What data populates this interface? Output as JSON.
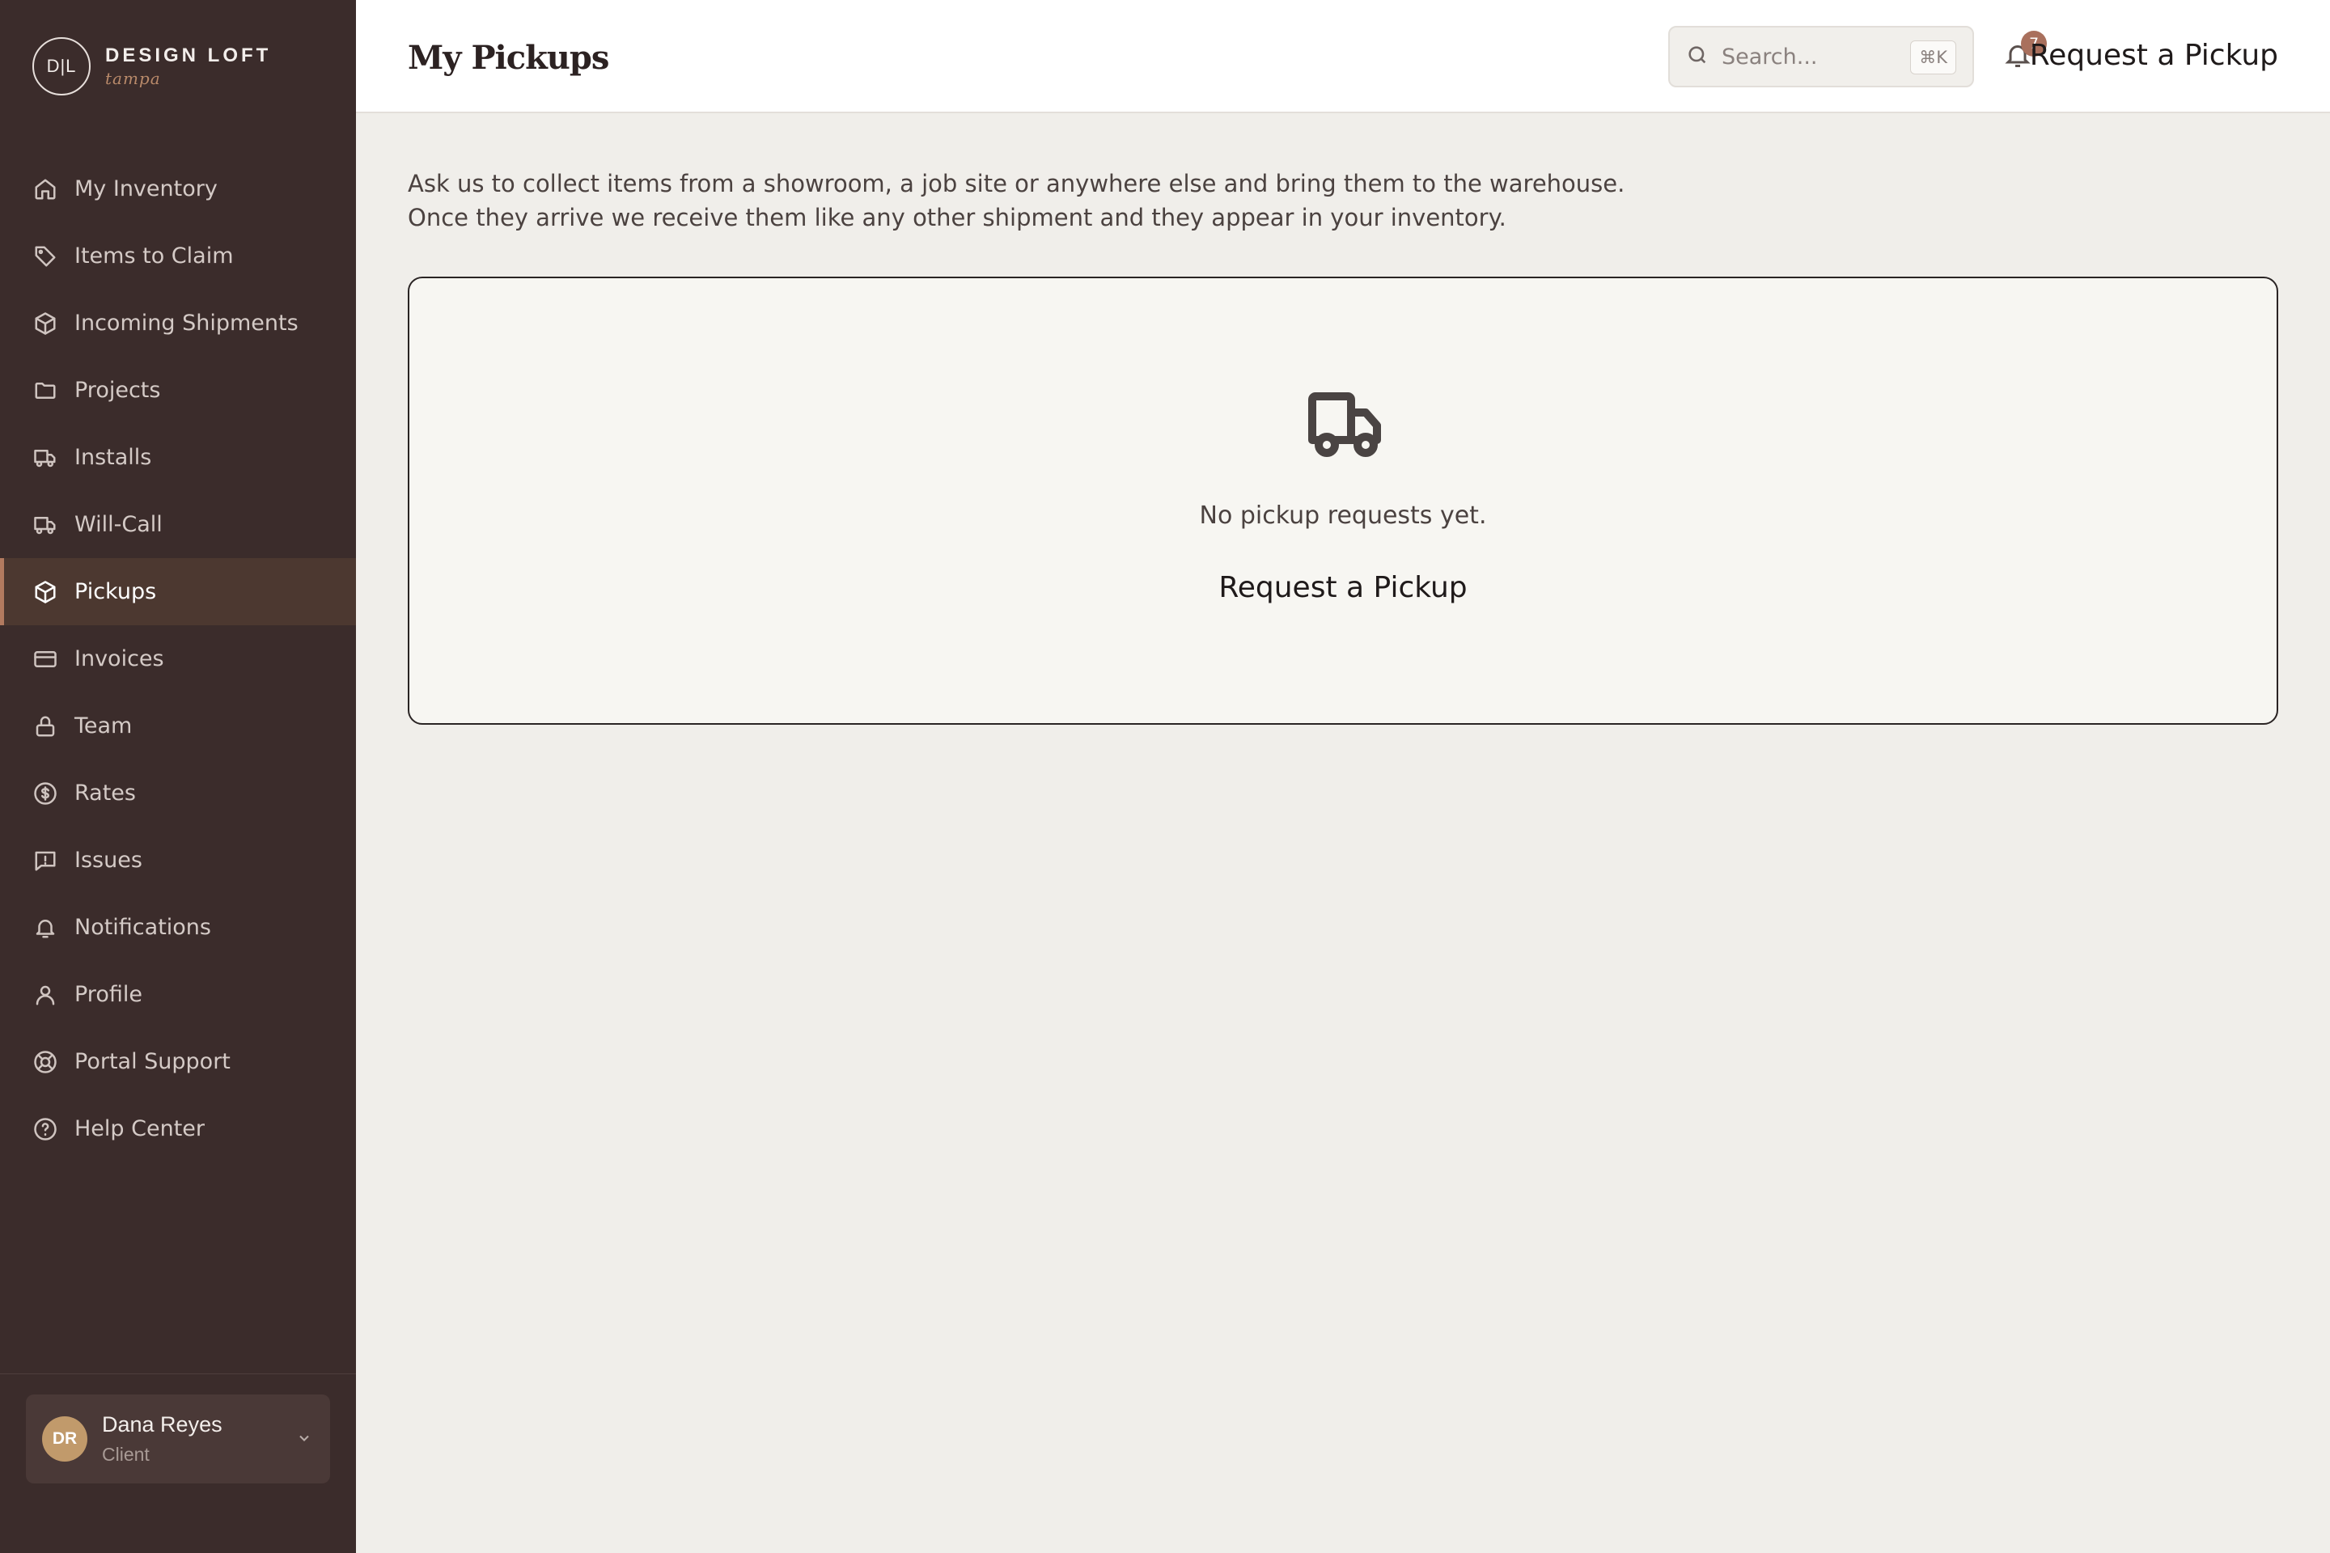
{
  "brand": {
    "initials": "D|L",
    "name": "DESIGN LOFT",
    "sub": "tampa"
  },
  "sidebar": {
    "items": [
      {
        "label": "My Inventory",
        "icon": "home-icon"
      },
      {
        "label": "Items to Claim",
        "icon": "tag-icon"
      },
      {
        "label": "Incoming Shipments",
        "icon": "box-icon"
      },
      {
        "label": "Projects",
        "icon": "folder-icon"
      },
      {
        "label": "Installs",
        "icon": "truck-icon"
      },
      {
        "label": "Will-Call",
        "icon": "truck-icon"
      },
      {
        "label": "Pickups",
        "icon": "box-icon",
        "active": true
      },
      {
        "label": "Invoices",
        "icon": "credit-card-icon"
      },
      {
        "label": "Team",
        "icon": "lock-icon"
      },
      {
        "label": "Rates",
        "icon": "dollar-circle-icon"
      },
      {
        "label": "Issues",
        "icon": "message-alert-icon"
      },
      {
        "label": "Notifications",
        "icon": "bell-icon"
      },
      {
        "label": "Profile",
        "icon": "user-icon"
      },
      {
        "label": "Portal Support",
        "icon": "life-buoy-icon"
      },
      {
        "label": "Help Center",
        "icon": "help-circle-icon"
      }
    ]
  },
  "user": {
    "initials": "DR",
    "name": "Dana Reyes",
    "role": "Client"
  },
  "header": {
    "title": "My Pickups",
    "search_placeholder": "Search...",
    "search_shortcut": "⌘K",
    "notification_count": "7",
    "cta_label": "Request a Pickup"
  },
  "main": {
    "intro_line1": "Ask us to collect items from a showroom, a job site or anywhere else and bring them to the warehouse.",
    "intro_line2": "Once they arrive we receive them like any other shipment and they appear in your inventory.",
    "empty_icon": "truck-icon",
    "empty_text": "No pickup requests yet.",
    "empty_cta": "Request a Pickup"
  },
  "colors": {
    "sidebar_bg": "#3b2c2b",
    "sidebar_active_bg": "#4c3830",
    "accent": "#b27a5f",
    "badge": "#a9705d",
    "avatar": "#c19a6b",
    "page_bg": "#f0eeea"
  }
}
